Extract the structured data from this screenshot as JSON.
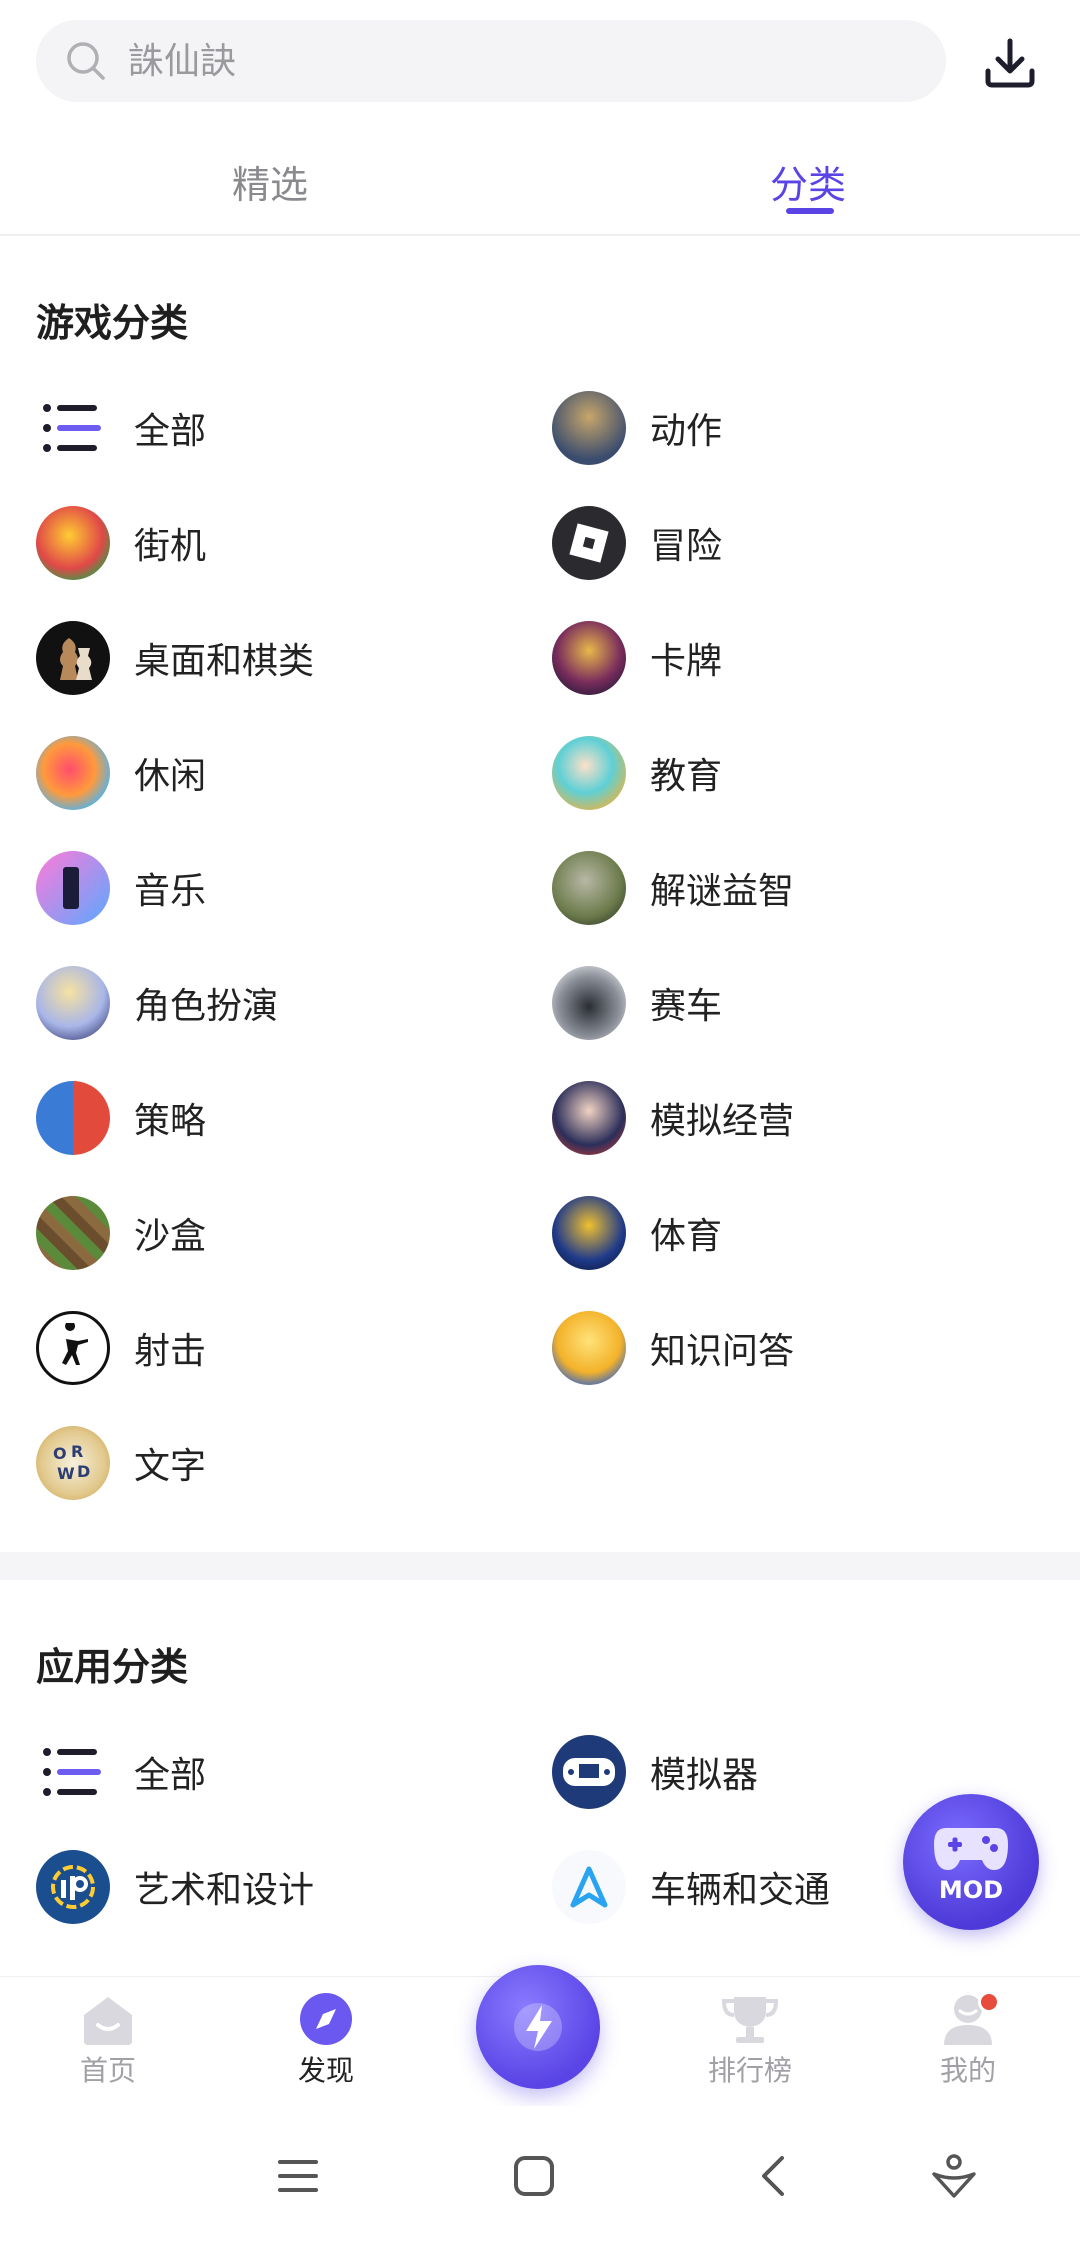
{
  "search": {
    "placeholder": "誅仙訣"
  },
  "tabs": [
    {
      "label": "精选"
    },
    {
      "label": "分类"
    }
  ],
  "game_section": {
    "title": "游戏分类",
    "items": [
      {
        "label": "全部",
        "icon": "list-icon"
      },
      {
        "label": "动作",
        "icon": "pubg-game-icon"
      },
      {
        "label": "街机",
        "icon": "subway-surfers-icon"
      },
      {
        "label": "冒险",
        "icon": "roblox-icon"
      },
      {
        "label": "桌面和棋类",
        "icon": "chess-icon"
      },
      {
        "label": "卡牌",
        "icon": "yugioh-icon"
      },
      {
        "label": "休闲",
        "icon": "candy-crush-icon"
      },
      {
        "label": "教育",
        "icon": "toca-boca-icon"
      },
      {
        "label": "音乐",
        "icon": "piano-tiles-icon"
      },
      {
        "label": "解谜益智",
        "icon": "talking-tom-icon"
      },
      {
        "label": "角色扮演",
        "icon": "anime-girl-icon"
      },
      {
        "label": "赛车",
        "icon": "racing-car-icon"
      },
      {
        "label": "策略",
        "icon": "clash-royale-icon"
      },
      {
        "label": "模拟经营",
        "icon": "sakura-school-icon"
      },
      {
        "label": "沙盒",
        "icon": "minecraft-icon"
      },
      {
        "label": "体育",
        "icon": "efootball-icon"
      },
      {
        "label": "射击",
        "icon": "counter-strike-icon"
      },
      {
        "label": "知识问答",
        "icon": "trivia-bulb-icon"
      },
      {
        "label": "文字",
        "icon": "word-game-icon"
      }
    ]
  },
  "app_section": {
    "title": "应用分类",
    "items": [
      {
        "label": "全部",
        "icon": "list-icon"
      },
      {
        "label": "模拟器",
        "icon": "emulator-icon"
      },
      {
        "label": "艺术和设计",
        "icon": "ibis-paint-icon"
      },
      {
        "label": "车辆和交通",
        "icon": "navigation-arrow-icon"
      }
    ]
  },
  "mod_button": {
    "label": "MOD"
  },
  "bottom_nav": [
    {
      "label": "首页",
      "icon": "home-icon"
    },
    {
      "label": "发现",
      "icon": "compass-icon"
    },
    {
      "label": "排行榜",
      "icon": "trophy-icon"
    },
    {
      "label": "我的",
      "icon": "profile-icon"
    }
  ],
  "colors": {
    "accent": "#5b44e6",
    "notification": "#e74c3c"
  }
}
